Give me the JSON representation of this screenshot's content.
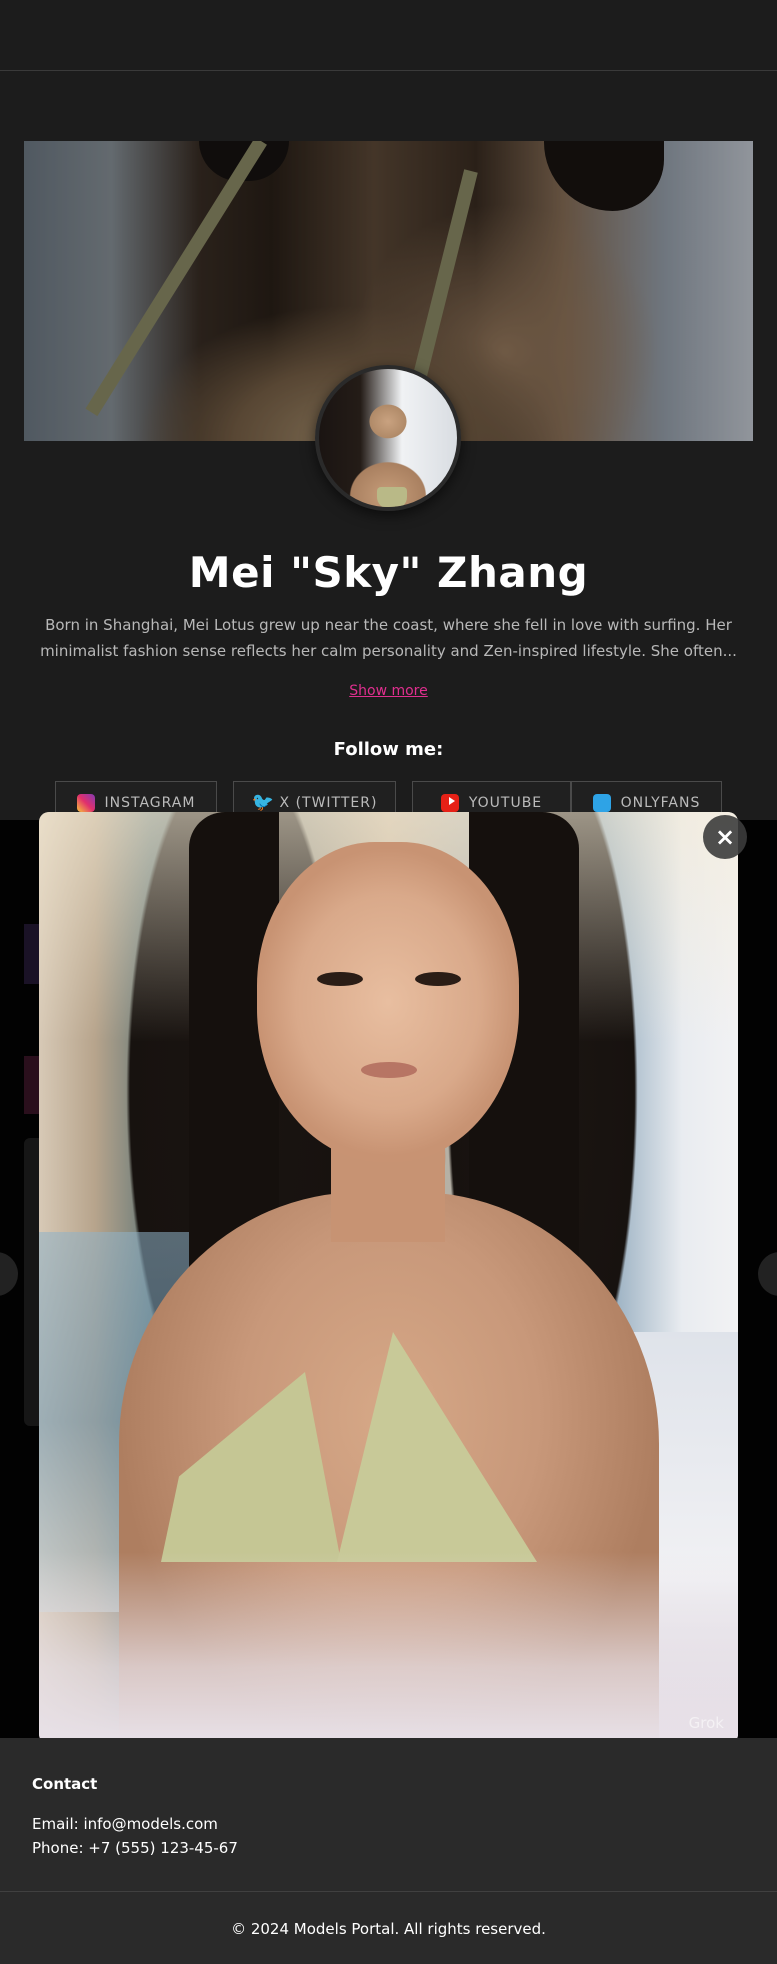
{
  "profile": {
    "name": "Mei \"Sky\" Zhang",
    "bio": "Born in Shanghai, Mei Lotus grew up near the coast, where she fell in love with surfing. Her minimalist fashion sense reflects her calm personality and Zen-inspired lifestyle. She often...",
    "show_more": "Show more"
  },
  "social": {
    "heading": "Follow me:",
    "links": [
      {
        "label": "INSTAGRAM",
        "icon": "instagram-icon"
      },
      {
        "label": "X (TWITTER)",
        "icon": "twitter-icon"
      },
      {
        "label": "YOUTUBE",
        "icon": "youtube-icon"
      },
      {
        "label": "ONLYFANS",
        "icon": "onlyfans-icon"
      }
    ]
  },
  "lightbox": {
    "close_label": "×",
    "watermark": "Grok"
  },
  "footer": {
    "contact_title": "Contact",
    "email": "Email: info@models.com",
    "phone": "Phone: +7 (555) 123-45-67",
    "copyright": "© 2024 Models Portal. All rights reserved."
  },
  "colors": {
    "background": "#1c1c1c",
    "accent_link": "#e02f8f",
    "footer_bg": "#2a2a2a"
  }
}
